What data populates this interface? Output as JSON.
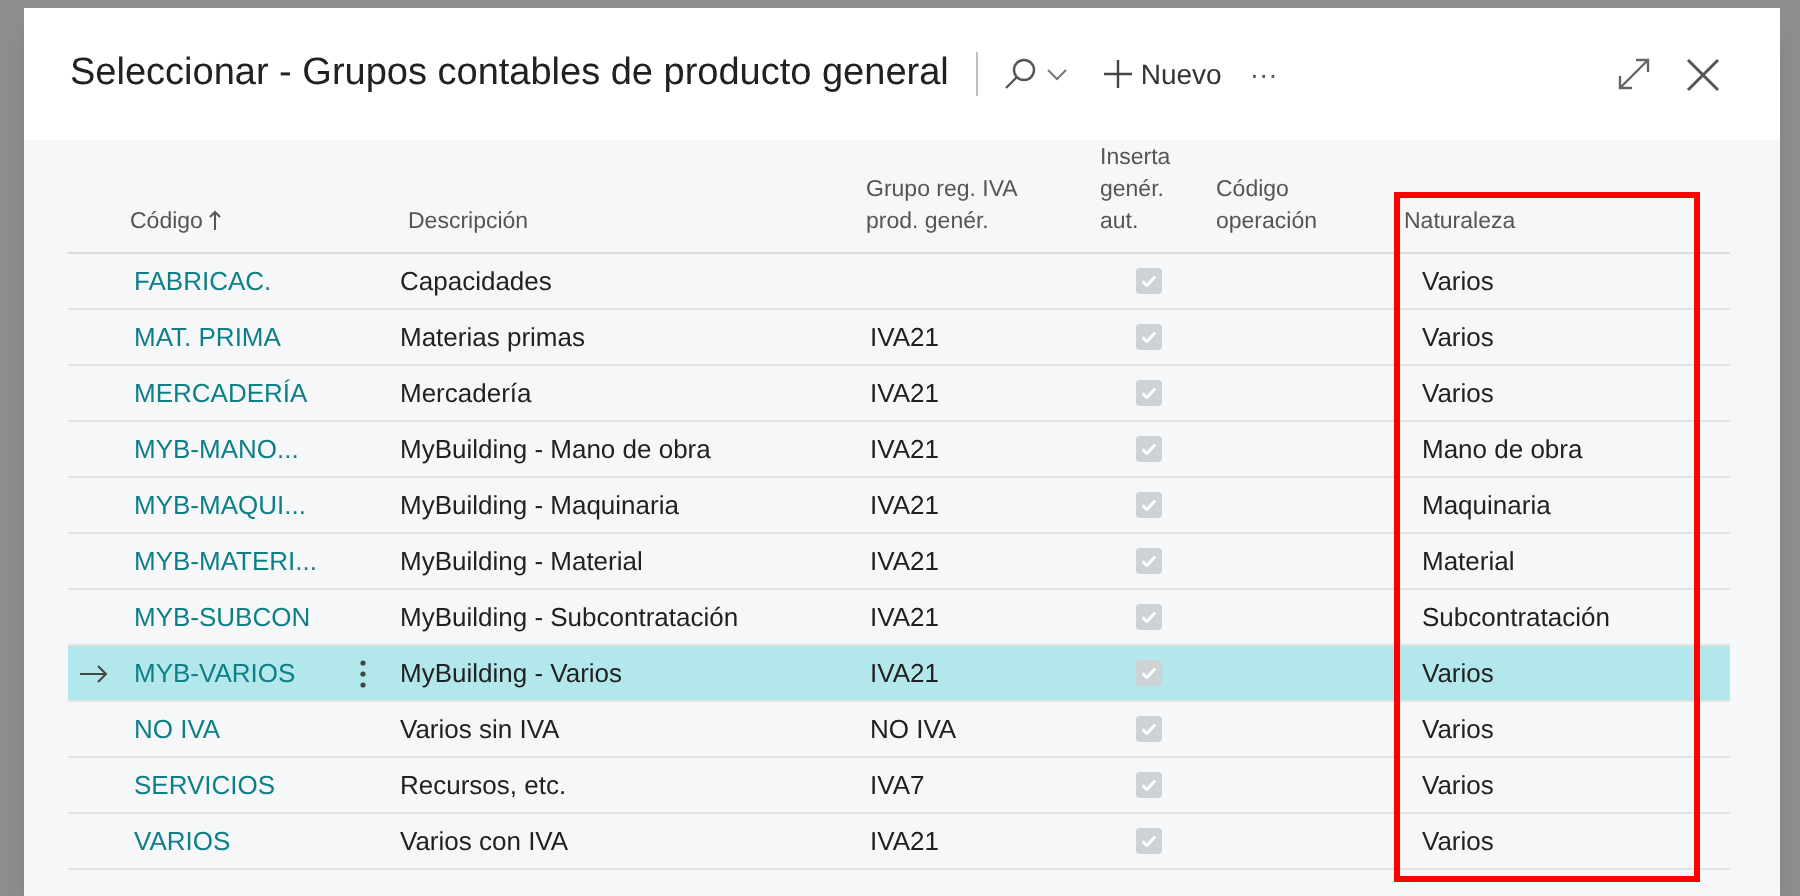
{
  "dialog": {
    "title": "Seleccionar - Grupos contables de producto general",
    "toolbar": {
      "new_label": "Nuevo",
      "more_label": "···"
    }
  },
  "table": {
    "columns": [
      {
        "label": "Código",
        "sorted": true
      },
      {
        "label": "Descripción",
        "sorted": false
      },
      {
        "label": "Grupo reg. IVA prod. genér.",
        "sorted": false
      },
      {
        "label": "Inserta genér. aut.",
        "sorted": false
      },
      {
        "label": "Código operación",
        "sorted": false
      },
      {
        "label": "Naturaleza",
        "sorted": false
      }
    ],
    "rows": [
      {
        "code": "FABRICAC.",
        "description": "Capacidades",
        "auto_insert": true,
        "nature": "Varios",
        "selected": false
      },
      {
        "code": "MAT. PRIMA",
        "description": "Materias primas",
        "vat_group": "IVA21",
        "auto_insert": true,
        "nature": "Varios",
        "selected": false
      },
      {
        "code": "MERCADERÍA",
        "description": "Mercadería",
        "vat_group": "IVA21",
        "auto_insert": true,
        "nature": "Varios",
        "selected": false
      },
      {
        "code": "MYB-MANO...",
        "description": "MyBuilding - Mano de obra",
        "vat_group": "IVA21",
        "auto_insert": true,
        "nature": "Mano de obra",
        "selected": false
      },
      {
        "code": "MYB-MAQUI...",
        "description": "MyBuilding - Maquinaria",
        "vat_group": "IVA21",
        "auto_insert": true,
        "nature": "Maquinaria",
        "selected": false
      },
      {
        "code": "MYB-MATERI...",
        "description": "MyBuilding - Material",
        "vat_group": "IVA21",
        "auto_insert": true,
        "nature": "Material",
        "selected": false
      },
      {
        "code": "MYB-SUBCON",
        "description": "MyBuilding - Subcontratación",
        "vat_group": "IVA21",
        "auto_insert": true,
        "nature": "Subcontratación",
        "selected": false
      },
      {
        "code": "MYB-VARIOS",
        "description": "MyBuilding - Varios",
        "vat_group": "IVA21",
        "auto_insert": true,
        "nature": "Varios",
        "selected": true
      },
      {
        "code": "NO IVA",
        "description": "Varios sin IVA",
        "vat_group": "NO IVA",
        "auto_insert": true,
        "nature": "Varios",
        "selected": false
      },
      {
        "code": "SERVICIOS",
        "description": "Recursos, etc.",
        "vat_group": "IVA7",
        "auto_insert": true,
        "nature": "Varios",
        "selected": false
      },
      {
        "code": "VARIOS",
        "description": "Varios con IVA",
        "vat_group": "IVA21",
        "auto_insert": true,
        "nature": "Varios",
        "selected": false
      }
    ]
  }
}
